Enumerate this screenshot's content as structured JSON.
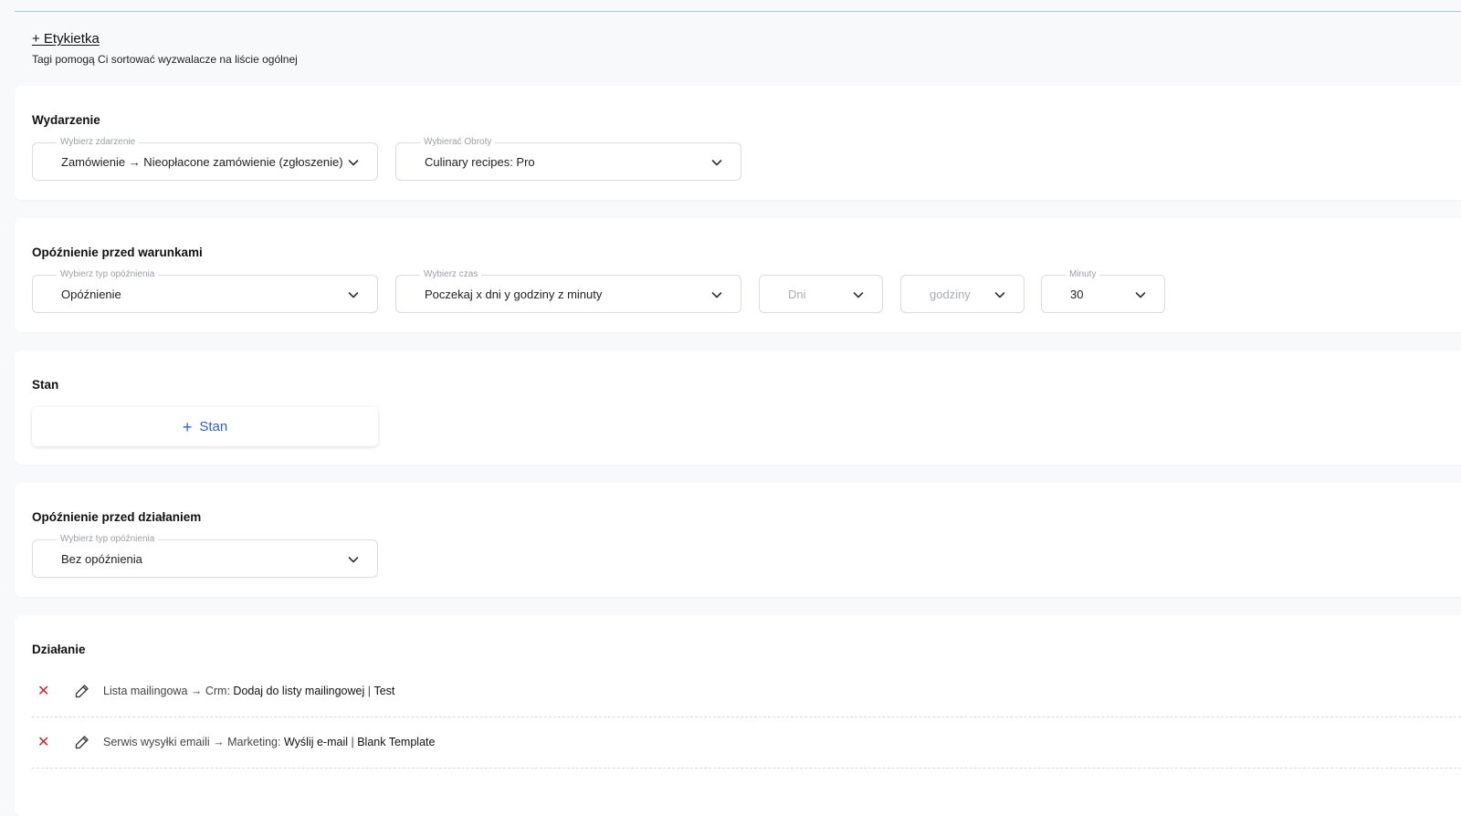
{
  "tag": {
    "link": "+ Etykietka",
    "hint": "Tagi pomogą Ci sortować wyzwalacze na liście ogólnej"
  },
  "event": {
    "title": "Wydarzenie",
    "select_event": {
      "label": "Wybierz zdarzenie",
      "value": "Zamówienie → Nieopłacone zamówienie (zgłoszenie)"
    },
    "select_turnover": {
      "label": "Wybierać Obroty",
      "value": "Culinary recipes: Pro"
    }
  },
  "delay_conditions": {
    "title": "Opóźnienie przed warunkami",
    "type": {
      "label": "Wybierz typ opóźnienia",
      "value": "Opóźnienie"
    },
    "time": {
      "label": "Wybierz czas",
      "value": "Poczekaj x dni y godziny z minuty"
    },
    "days": {
      "placeholder": "Dni"
    },
    "hours": {
      "placeholder": "godziny"
    },
    "minutes": {
      "label": "Minuty",
      "value": "30"
    }
  },
  "condition": {
    "title": "Stan",
    "add_label": "Stan"
  },
  "delay_action": {
    "title": "Opóźnienie przed działaniem",
    "type": {
      "label": "Wybierz typ opóźnienia",
      "value": "Bez opóźnienia"
    }
  },
  "action": {
    "title": "Działanie",
    "items": [
      {
        "desc": "Lista mailingowa → Crm:",
        "action": "Dodaj do listy mailingowej",
        "sep": "|",
        "target": "Test"
      },
      {
        "desc": "Serwis wysyłki emaili → Marketing:",
        "action": "Wyślij e-mail",
        "sep": "|",
        "target": "Blank Template"
      }
    ]
  },
  "icons": {
    "dropdown": "chevron-down-icon",
    "delete": "close-icon",
    "edit": "pencil-icon",
    "add": "plus-icon"
  },
  "colors": {
    "accent": "#2f5fd0",
    "danger": "#d9232e",
    "border": "#d9dce2",
    "background": "#f8f9fb"
  }
}
